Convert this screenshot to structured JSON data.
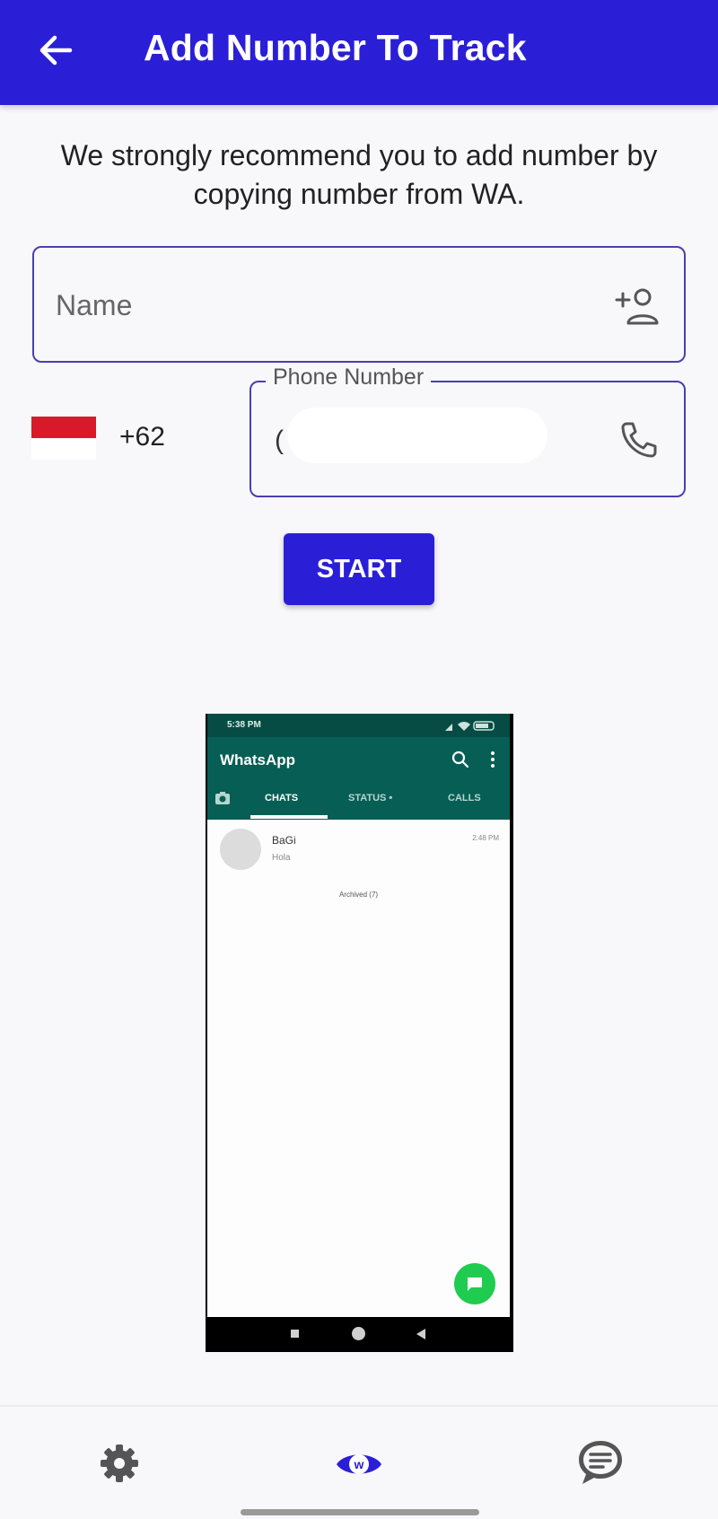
{
  "header": {
    "title": "Add Number To Track",
    "back_icon": "arrow-left-icon"
  },
  "intro_text": "We strongly recommend you to add number by copying number from WA.",
  "form": {
    "name": {
      "placeholder": "Name",
      "value": "",
      "icon": "add-person-icon"
    },
    "country": {
      "flag": "indonesia-flag",
      "dial_code": "+62"
    },
    "phone": {
      "label": "Phone Number",
      "value": "(",
      "icon": "phone-icon"
    },
    "start_label": "START"
  },
  "preview": {
    "status_time": "5:38 PM",
    "app_name": "WhatsApp",
    "tabs": [
      {
        "label": "CHATS",
        "active": true
      },
      {
        "label": "STATUS •",
        "active": false
      },
      {
        "label": "CALLS",
        "active": false
      }
    ],
    "chat": {
      "name": "BaGi",
      "message": "Hola",
      "time": "2:48 PM"
    },
    "archived": "Archived (7)"
  },
  "bottom_nav": {
    "items": [
      {
        "name": "settings",
        "icon": "gear-icon"
      },
      {
        "name": "track",
        "icon": "eye-w-icon",
        "active": true
      },
      {
        "name": "chat",
        "icon": "chat-bubble-icon"
      }
    ]
  },
  "colors": {
    "primary": "#2a1fd6",
    "field_border": "#4a3fb2",
    "whatsapp_green": "#075e54",
    "fab_green": "#1fcc4f"
  }
}
